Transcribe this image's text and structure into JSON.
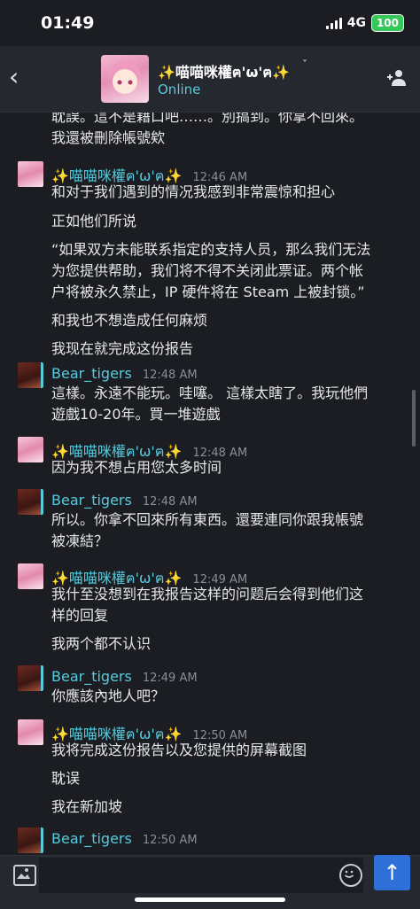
{
  "status": {
    "time": "01:49",
    "network": "4G",
    "battery": "100"
  },
  "header": {
    "name": "✨喵喵咪權ฅ'ω'ฅ✨",
    "presence": "Online"
  },
  "messages": [
    {
      "continuation": true,
      "lines": [
        "耽誤。這不是藉口吧……。別搞到。你拿不回來。",
        "我還被刪除帳號欸"
      ]
    },
    {
      "sender": "✨喵喵咪權ฅ'ω'ฅ✨",
      "avatar": "pink",
      "time": "12:46 AM",
      "lines": [
        "和对于我们遇到的情况我感到非常震惊和担心",
        "正如他们所说",
        "“如果双方未能联系指定的支持人员，那么我们无法",
        "为您提供帮助，我们将不得不关闭此票证。两个帐",
        "户将被永久禁止，IP 硬件将在 Steam 上被封锁。”",
        "和我也不想造成任何麻烦",
        "我现在就完成这份报告"
      ]
    },
    {
      "sender": "Bear_tigers",
      "avatar": "bear",
      "time": "12:48 AM",
      "lines": [
        "這樣。永遠不能玩。哇噻。 這樣太瞎了。我玩他們",
        "遊戲10-20年。買一堆遊戲"
      ]
    },
    {
      "sender": "✨喵喵咪權ฅ'ω'ฅ✨",
      "avatar": "pink",
      "time": "12:48 AM",
      "lines": [
        "因为我不想占用您太多时间"
      ]
    },
    {
      "sender": "Bear_tigers",
      "avatar": "bear",
      "time": "12:48 AM",
      "lines": [
        "所以。你拿不回來所有東西。還要連同你跟我帳號",
        "被凍結？"
      ]
    },
    {
      "sender": "✨喵喵咪權ฅ'ω'ฅ✨",
      "avatar": "pink",
      "time": "12:49 AM",
      "lines": [
        "我什至没想到在我报告这样的问题后会得到他们这",
        "样的回复",
        "我两个都不认识"
      ]
    },
    {
      "sender": "Bear_tigers",
      "avatar": "bear",
      "time": "12:49 AM",
      "lines": [
        "你應該內地人吧？"
      ]
    },
    {
      "sender": "✨喵喵咪權ฅ'ω'ฅ✨",
      "avatar": "pink",
      "time": "12:50 AM",
      "lines": [
        "我将完成这份报告以及您提供的屏幕截图",
        "耽误",
        "我在新加坡"
      ]
    },
    {
      "sender": "Bear_tigers",
      "avatar": "bear",
      "time": "12:50 AM",
      "lines": []
    }
  ],
  "composer": {
    "value": "",
    "placeholder": "",
    "send_icon": "arrow-up-icon"
  },
  "colors": {
    "accent": "#57cbde",
    "send": "#2f6fd8",
    "background": "#1b1d22"
  }
}
